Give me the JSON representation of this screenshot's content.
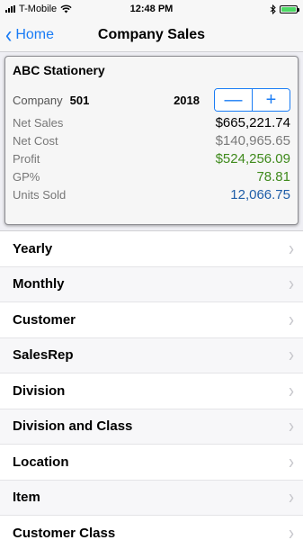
{
  "status_bar": {
    "carrier": "T-Mobile",
    "time": "12:48 PM"
  },
  "nav": {
    "back_label": "Home",
    "title": "Company Sales"
  },
  "summary": {
    "company_name": "ABC Stationery",
    "company_label": "Company",
    "company_number": "501",
    "year": "2018",
    "stepper": {
      "minus": "—",
      "plus": "+"
    },
    "metrics": [
      {
        "label": "Net Sales",
        "value": "$665,221.74",
        "color": "#000000"
      },
      {
        "label": "Net Cost",
        "value": "$140,965.65",
        "color": "#7a7a7a"
      },
      {
        "label": "Profit",
        "value": "$524,256.09",
        "color": "#3f8a1c"
      },
      {
        "label": "GP%",
        "value": "78.81",
        "color": "#3f8a1c"
      },
      {
        "label": "Units Sold",
        "value": "12,066.75",
        "color": "#1f5ea8"
      }
    ]
  },
  "list": {
    "items": [
      {
        "label": "Yearly"
      },
      {
        "label": "Monthly"
      },
      {
        "label": "Customer"
      },
      {
        "label": "SalesRep"
      },
      {
        "label": "Division"
      },
      {
        "label": "Division and Class"
      },
      {
        "label": "Location"
      },
      {
        "label": "Item"
      },
      {
        "label": "Customer Class"
      }
    ]
  },
  "colors": {
    "accent": "#1a7cf5",
    "battery": "#4cd964"
  }
}
